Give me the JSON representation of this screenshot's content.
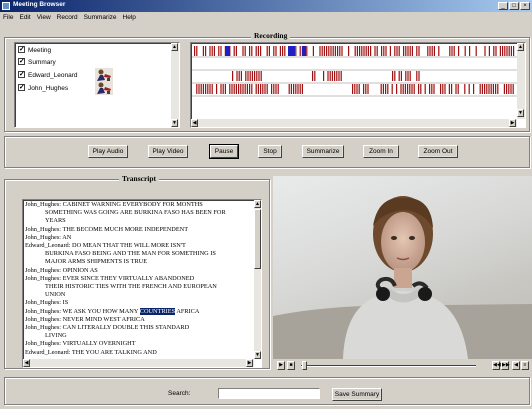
{
  "window": {
    "title": "Meeting Browser",
    "controls": [
      "_",
      "□",
      "×"
    ]
  },
  "menu": [
    "File",
    "Edit",
    "View",
    "Record",
    "Summarize",
    "Help"
  ],
  "recording": {
    "title": "Recording",
    "tracks": [
      {
        "label": "Meeting",
        "checked": true,
        "has_avatar": false
      },
      {
        "label": "Summary",
        "checked": true,
        "has_avatar": false
      },
      {
        "label": "Edward_Leonard",
        "checked": true,
        "has_avatar": true
      },
      {
        "label": "John_Hughes",
        "checked": true,
        "has_avatar": true
      }
    ]
  },
  "controls": {
    "buttons": [
      "Play Audio",
      "Play Video",
      "Pause",
      "Stop",
      "Summarize",
      "Zoom In",
      "Zoom Out"
    ]
  },
  "transcript": {
    "title": "Transcript",
    "lines": [
      {
        "text": "John_Hughes:  CABINET WARNING EVERYBODY FOR MONTHS",
        "cont": false
      },
      {
        "text": "SOMETHING WAS GOING ARE BURKINA FASO HAS BEEN FOR",
        "cont": true
      },
      {
        "text": "YEARS",
        "cont": true
      },
      {
        "text": "John_Hughes:  THE BECOME MUCH MORE INDEPENDENT",
        "cont": false
      },
      {
        "text": "John_Hughes:  AN",
        "cont": false
      },
      {
        "text": "Edward_Leonard:  DO MEAN THAT THE WILL MORE ISN'T",
        "cont": false
      },
      {
        "text": "BURKINA FASO BEING AND THE MAN FOR SOMETHING IS",
        "cont": true
      },
      {
        "text": "MAJOR ARMS SHIPMENTS IS TRUE",
        "cont": true
      },
      {
        "text": "John_Hughes:  OPINION AS",
        "cont": false
      },
      {
        "text": "John_Hughes:  EVER SINCE THEY VIRTUALLY ABANDONED",
        "cont": false
      },
      {
        "text": "THEIR HISTORIC TIES WITH THE FRENCH AND EUROPEAN",
        "cont": true
      },
      {
        "text": "UNION",
        "cont": true
      },
      {
        "text": "John_Hughes:  IS",
        "cont": false
      },
      {
        "text": "John_Hughes:  WE ASK YOU HOW MANY",
        "cont": false,
        "highlight": "COUNTRIES",
        "after": " AFRICA"
      },
      {
        "text": "John_Hughes:  NEVER MIND WEST AFRICA",
        "cont": false
      },
      {
        "text": "John_Hughes:  CAN LITERALLY DOUBLE THIS STANDARD",
        "cont": false
      },
      {
        "text": "LIVING",
        "cont": true
      },
      {
        "text": "John_Hughes:  VIRTUALLY OVERNIGHT",
        "cont": false
      },
      {
        "text": "Edward_Leonard:  THE YOU ARE TALKING AND",
        "cont": false
      }
    ]
  },
  "player": {
    "progress": 0.0
  },
  "footer": {
    "search_label": "Search:",
    "search_value": "",
    "save_label": "Save Summary"
  },
  "colors": {
    "timeline_red": "#a01010",
    "timeline_blue": "#2020c0",
    "highlight": "#0a246a"
  }
}
